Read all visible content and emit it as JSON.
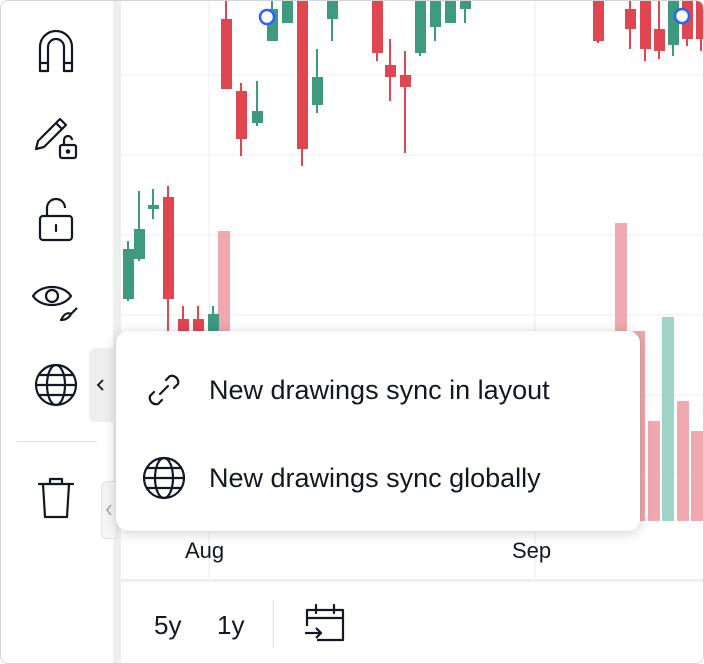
{
  "colors": {
    "up": "#3d9a7f",
    "down": "#e0464f",
    "up_volume": "#9fd3c5",
    "down_volume": "#f0a9ae",
    "marker": "#2962ff",
    "text": "#131722"
  },
  "toolbar": {
    "items": [
      {
        "name": "magnet-icon"
      },
      {
        "name": "pencil-lock-icon"
      },
      {
        "name": "lock-open-icon"
      },
      {
        "name": "eye-pen-icon"
      },
      {
        "name": "globe-icon"
      },
      {
        "name": "trash-icon"
      }
    ]
  },
  "chart": {
    "date_labels": {
      "aug": "Aug",
      "sep": "Sep"
    }
  },
  "sync_menu": {
    "items": [
      {
        "icon": "link-icon",
        "label": "New drawings sync in layout"
      },
      {
        "icon": "globe-icon",
        "label": "New drawings sync globally"
      }
    ]
  },
  "bottom_bar": {
    "range_5y": "5y",
    "range_1y": "1y",
    "goto_date_icon": "calendar-arrow-icon"
  }
}
